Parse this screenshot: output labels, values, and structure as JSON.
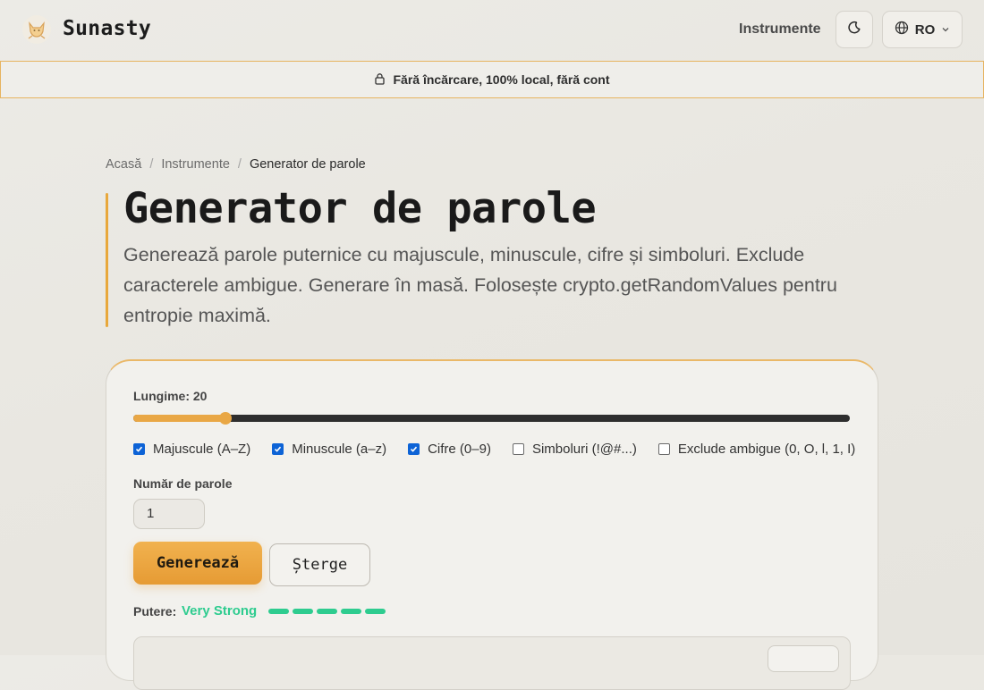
{
  "header": {
    "brand": "Sunasty",
    "nav_tools": "Instrumente",
    "language": "RO"
  },
  "banner": {
    "text": "Fără încărcare, 100% local, fără cont"
  },
  "breadcrumb": {
    "home": "Acasă",
    "tools": "Instrumente",
    "current": "Generator de parole",
    "separator": "/"
  },
  "hero": {
    "title": "Generator de parole",
    "description": "Generează parole puternice cu majuscule, minuscule, cifre și simboluri. Exclude caracterele ambigue. Generare în masă. Folosește crypto.getRandomValues pentru entropie maximă."
  },
  "form": {
    "length_label": "Lungime: 20",
    "length": {
      "value": 20,
      "min": 4,
      "max": 128
    },
    "options": [
      {
        "label": "Majuscule (A–Z)",
        "checked": true
      },
      {
        "label": "Minuscule (a–z)",
        "checked": true
      },
      {
        "label": "Cifre (0–9)",
        "checked": true
      },
      {
        "label": "Simboluri (!@#...)",
        "checked": false
      },
      {
        "label": "Exclude ambigue (0, O, l, 1, I)",
        "checked": false
      }
    ],
    "count_label": "Număr de parole",
    "count_value": "1",
    "generate_label": "Generează",
    "clear_label": "Șterge",
    "strength_label": "Putere:",
    "strength_value": "Very Strong",
    "strength_level": 5,
    "strength_max": 5
  },
  "colors": {
    "accent": "#e9a745",
    "strength": "#2ecc8f",
    "checkbox": "#0d63d6"
  }
}
